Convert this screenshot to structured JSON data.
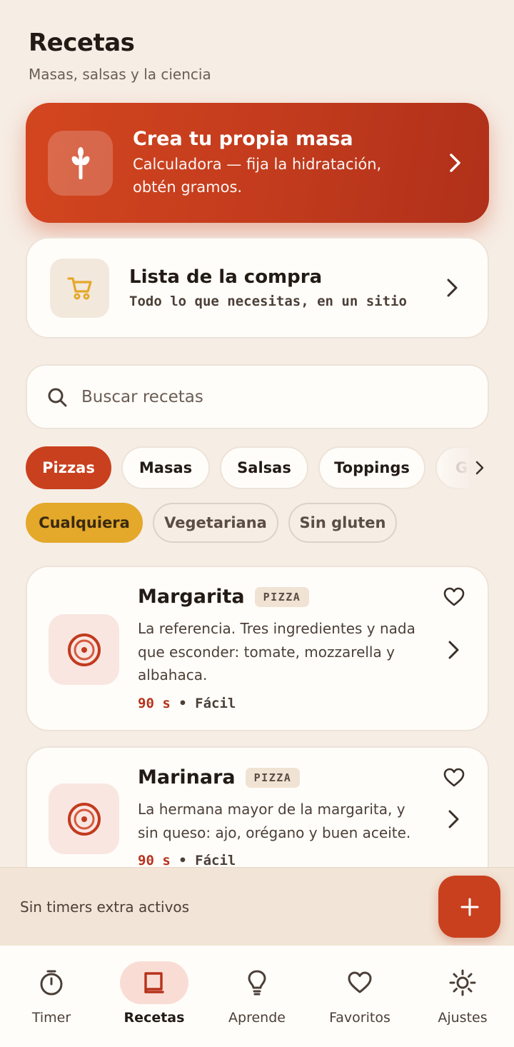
{
  "header": {
    "title": "Recetas",
    "subtitle": "Masas, salsas y la ciencia"
  },
  "hero": {
    "title": "Crea tu propia masa",
    "subtitle": "Calculadora — fija la hidratación, obtén gramos.",
    "icon": "wheat-icon",
    "color": "#c9401e"
  },
  "shopping": {
    "title": "Lista de la compra",
    "subtitle": "Todo lo que necesitas, en un sitio",
    "icon": "cart-icon",
    "icon_color": "#e4a82a"
  },
  "search": {
    "placeholder": "Buscar recetas"
  },
  "categories": [
    {
      "label": "Pizzas",
      "active": true
    },
    {
      "label": "Masas",
      "active": false
    },
    {
      "label": "Salsas",
      "active": false
    },
    {
      "label": "Toppings",
      "active": false
    },
    {
      "label": "G",
      "active": false
    }
  ],
  "filters": [
    {
      "label": "Cualquiera",
      "active": true
    },
    {
      "label": "Vegetariana",
      "active": false
    },
    {
      "label": "Sin gluten",
      "active": false
    }
  ],
  "recipes": [
    {
      "name": "Margarita",
      "tag": "PIZZA",
      "description": "La referencia. Tres ingredientes y nada que esconder: tomate, mozzarella y albahaca.",
      "time": "90 s",
      "separator": "•",
      "difficulty": "Fácil"
    },
    {
      "name": "Marinara",
      "tag": "PIZZA",
      "description": "La hermana mayor de la margarita, y sin queso: ajo, orégano y buen aceite.",
      "time": "90 s",
      "separator": "•",
      "difficulty": "Fácil"
    }
  ],
  "timer_bar": {
    "status": "Sin timers extra activos",
    "add_icon": "plus-icon"
  },
  "nav": [
    {
      "label": "Timer",
      "icon": "stopwatch-icon",
      "active": false
    },
    {
      "label": "Recetas",
      "icon": "book-icon",
      "active": true
    },
    {
      "label": "Aprende",
      "icon": "lightbulb-icon",
      "active": false
    },
    {
      "label": "Favoritos",
      "icon": "heart-icon",
      "active": false
    },
    {
      "label": "Ajustes",
      "icon": "sun-icon",
      "active": false
    }
  ],
  "colors": {
    "background": "#f6ede5",
    "accent": "#c9401e",
    "filter_active": "#e4a82a",
    "text": "#221a15"
  }
}
